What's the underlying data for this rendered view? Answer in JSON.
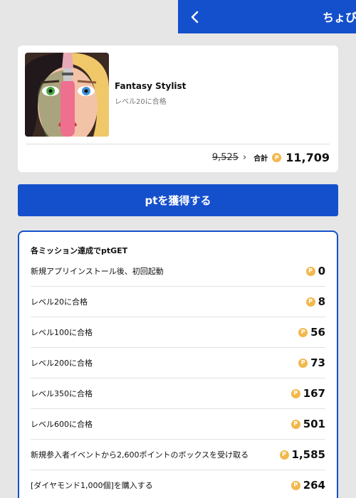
{
  "header": {
    "title": "ちょびリッチ",
    "back_icon": "chevron-left-icon",
    "color": "#1550cc"
  },
  "app": {
    "name": "Fantasy Stylist",
    "subtitle": "レベル20に合格",
    "old_price": "9,525",
    "total_label": "合計",
    "total_value": "11,709",
    "coin_glyph": "P"
  },
  "cta": {
    "label": "ptを獲得する"
  },
  "missions": {
    "title": "各ミッション達成でptGET",
    "items": [
      {
        "label": "新規アプリインストール後、初回起動",
        "points": "0"
      },
      {
        "label": "レベル20に合格",
        "points": "8"
      },
      {
        "label": "レベル100に合格",
        "points": "56"
      },
      {
        "label": "レベル200に合格",
        "points": "73"
      },
      {
        "label": "レベル350に合格",
        "points": "167"
      },
      {
        "label": "レベル600に合格",
        "points": "501"
      },
      {
        "label": "新規参入者イベントから2,600ポイントのボックスを受け取る",
        "points": "1,585"
      },
      {
        "label": "[ダイヤモンド1,000個]を購入する",
        "points": "264"
      }
    ]
  }
}
